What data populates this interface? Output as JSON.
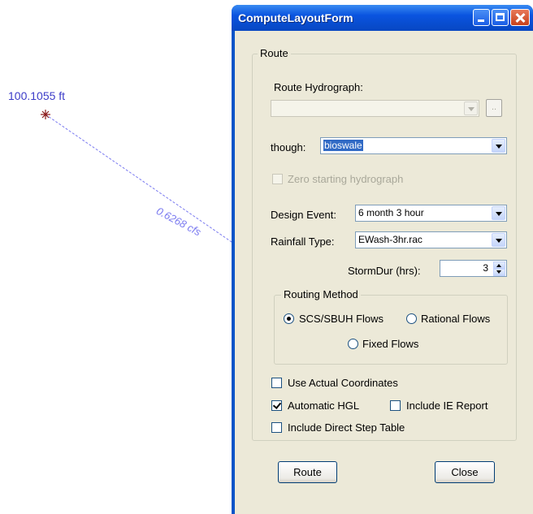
{
  "canvas": {
    "elevation_label": "100.1055 ft",
    "flow_label": "0.6268 cfs",
    "line_color": "#7a7af0",
    "node_color": "#8b1a1a"
  },
  "window": {
    "title": "ComputeLayoutForm"
  },
  "route_group": {
    "legend": "Route",
    "hydrograph_label": "Route Hydrograph:",
    "hydrograph_value": "",
    "browse_button": "..",
    "through_label": "though:",
    "through_value": "bioswale",
    "zero_starting_label": "Zero starting hydrograph",
    "zero_starting_checked": false,
    "design_event_label": "Design Event:",
    "design_event_value": "6 month 3 hour",
    "rainfall_type_label": "Rainfall Type:",
    "rainfall_type_value": "EWash-3hr.rac",
    "storm_dur_label": "StormDur (hrs):",
    "storm_dur_value": "3"
  },
  "routing_method": {
    "legend": "Routing Method",
    "options": [
      {
        "label": "SCS/SBUH Flows",
        "selected": true
      },
      {
        "label": "Rational Flows",
        "selected": false
      },
      {
        "label": "Fixed Flows",
        "selected": false
      }
    ]
  },
  "options": {
    "use_actual_coords": {
      "label": "Use Actual Coordinates",
      "checked": false
    },
    "automatic_hgl": {
      "label": "Automatic HGL",
      "checked": true
    },
    "include_ie_report": {
      "label": "Include IE Report",
      "checked": false
    },
    "include_direct_step": {
      "label": "Include Direct Step Table",
      "checked": false
    }
  },
  "buttons": {
    "route": "Route",
    "close": "Close"
  }
}
